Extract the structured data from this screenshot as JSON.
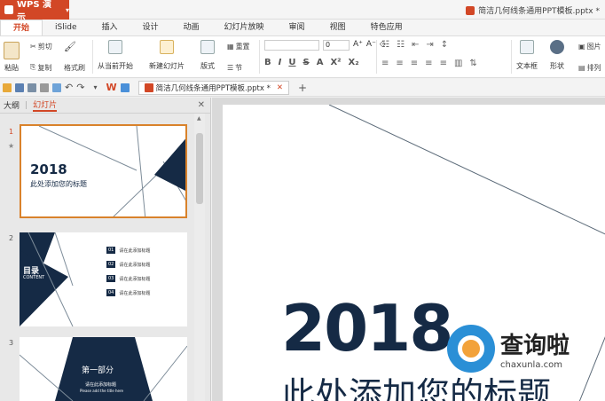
{
  "app": {
    "name": "WPS 演示",
    "doc_title": "简洁几何线条通用PPT模板.pptx *"
  },
  "tabs": [
    "开始",
    "iSlide",
    "插入",
    "设计",
    "动画",
    "幻灯片放映",
    "审阅",
    "视图",
    "特色应用"
  ],
  "ribbon": {
    "paste": "粘贴",
    "cut": "剪切",
    "copy": "复制",
    "format_painter": "格式刷",
    "from_current": "从当前开始",
    "new_slide": "新建幻灯片",
    "layout": "版式",
    "reset": "重置",
    "section": "节",
    "font_size": "0",
    "text_box": "文本框",
    "shape": "形状",
    "picture": "图片",
    "arrange": "排列"
  },
  "qat": {
    "doc_tab": "简洁几何线条通用PPT模板.pptx *"
  },
  "left_panel": {
    "tabs": [
      "大纲",
      "幻灯片"
    ],
    "slides": [
      {
        "num": "1",
        "year": "2018",
        "subtitle": "此处添加您的标题"
      },
      {
        "num": "2",
        "heading": "目录",
        "heading_en": "CONTENT",
        "items": [
          {
            "n": "01",
            "text": "请在此添加标题"
          },
          {
            "n": "02",
            "text": "请在此添加标题"
          },
          {
            "n": "03",
            "text": "请在此添加标题"
          },
          {
            "n": "04",
            "text": "请在此添加标题"
          }
        ]
      },
      {
        "num": "3",
        "heading": "第一部分",
        "sub": "请在此添加标题",
        "sub_en": "Please add the title here"
      }
    ]
  },
  "main_slide": {
    "year": "2018",
    "title": "此处添加您的标题"
  },
  "watermark": {
    "cn": "查询啦",
    "en": "chaxunla.com"
  },
  "colors": {
    "accent": "#d24726",
    "navy": "#152a45",
    "selection": "#d9822b"
  }
}
